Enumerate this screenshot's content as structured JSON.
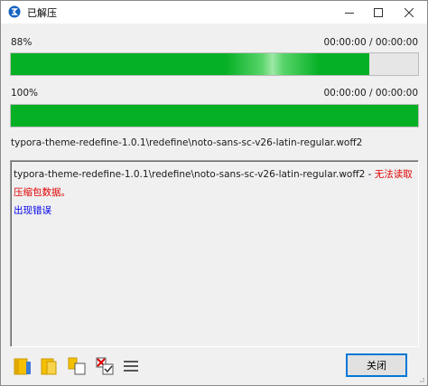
{
  "window": {
    "title": "已解压",
    "accent_color": "#0078d7"
  },
  "progress_overall": {
    "label": "88%",
    "value": 0.88,
    "time": "00:00:00 / 00:00:00"
  },
  "progress_file": {
    "label": "100%",
    "value": 1.0,
    "time": "00:00:00 / 00:00:00"
  },
  "current_file": "typora-theme-redefine-1.0.1\\redefine\\noto-sans-sc-v26-latin-regular.woff2",
  "log": {
    "path": "typora-theme-redefine-1.0.1\\redefine\\noto-sans-sc-v26-latin-regular.woff2",
    "separator": " - ",
    "error": "无法读取压缩包数据。",
    "status": "出现错误"
  },
  "toolbar": {
    "icons": [
      "folder-icon",
      "open-folder-icon",
      "copy-icon",
      "delete-files-icon",
      "menu-icon"
    ]
  },
  "buttons": {
    "close_label": "关闭"
  },
  "colors": {
    "progress_fill": "#06b025",
    "error_text": "#e00000",
    "status_text": "#0000ee"
  }
}
